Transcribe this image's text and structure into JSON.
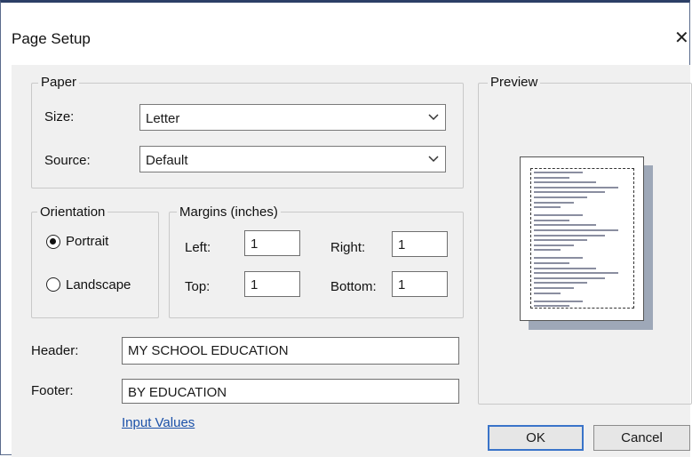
{
  "window": {
    "title": "Page Setup",
    "close_glyph": "✕"
  },
  "paper": {
    "legend": "Paper",
    "size_label": "Size:",
    "size_value": "Letter",
    "source_label": "Source:",
    "source_value": "Default"
  },
  "orientation": {
    "legend": "Orientation",
    "portrait_label": "Portrait",
    "landscape_label": "Landscape",
    "selected": "Portrait"
  },
  "margins": {
    "legend": "Margins (inches)",
    "left_label": "Left:",
    "left_value": "1",
    "right_label": "Right:",
    "right_value": "1",
    "top_label": "Top:",
    "top_value": "1",
    "bottom_label": "Bottom:",
    "bottom_value": "1"
  },
  "header": {
    "label": "Header:",
    "value": "MY SCHOOL EDUCATION"
  },
  "footer": {
    "label": "Footer:",
    "value": "BY EDUCATION"
  },
  "links": {
    "input_values": "Input Values"
  },
  "preview": {
    "legend": "Preview"
  },
  "buttons": {
    "ok": "OK",
    "cancel": "Cancel"
  },
  "colors": {
    "accent": "#3a74c9",
    "link": "#1a50a8",
    "dialog_bg": "#f0f0f0",
    "title_border": "#2c3f66"
  },
  "icons": {
    "dropdown": "chevron-down-icon",
    "close": "close-icon"
  }
}
